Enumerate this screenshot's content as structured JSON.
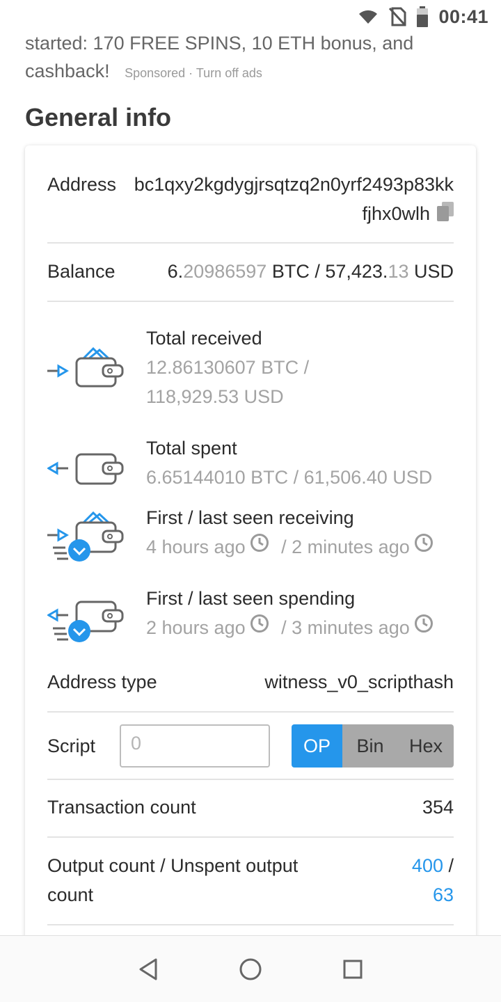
{
  "status_bar": {
    "time": "00:41"
  },
  "ad": {
    "text": "started: 170 FREE SPINS, 10 ETH bonus, and cashback!",
    "sponsored": "Sponsored",
    "separator": " · ",
    "turn_off": "Turn off ads"
  },
  "section_title": "General info",
  "address": {
    "label": "Address",
    "value": "bc1qxy2kgdygjrsqtzq2n0yrf2493p83kkfjhx0wlh"
  },
  "balance": {
    "label": "Balance",
    "btc_int": "6.",
    "btc_frac": "20986597",
    "btc_unit": " BTC / ",
    "usd_int": "57,423.",
    "usd_frac": "13",
    "usd_unit": " USD"
  },
  "total_received": {
    "title": "Total received",
    "btc": "12.86130607 BTC /",
    "usd": "118,929.53 USD"
  },
  "total_spent": {
    "title": "Total spent",
    "value": "6.65144010 BTC / 61,506.40 USD"
  },
  "seen_receiving": {
    "title": "First / last seen receiving",
    "first": "4 hours ago",
    "last": "/ 2 minutes ago"
  },
  "seen_spending": {
    "title": "First / last seen spending",
    "first": "2 hours ago",
    "last": "/ 3 minutes ago"
  },
  "address_type": {
    "label": "Address type",
    "value": "witness_v0_scripthash"
  },
  "script": {
    "label": "Script",
    "value": "0",
    "modes": [
      "OP",
      "Bin",
      "Hex"
    ],
    "active_mode": "OP"
  },
  "transaction_count": {
    "label": "Transaction count",
    "value": "354"
  },
  "output_count": {
    "label_line1": "Output count / Unspent output",
    "label_line2": "count",
    "outputs": "400",
    "sep": " /",
    "unspent": "63"
  },
  "colors": {
    "accent": "#2596eb",
    "muted": "#a3a3a3",
    "icon": "#666666"
  }
}
